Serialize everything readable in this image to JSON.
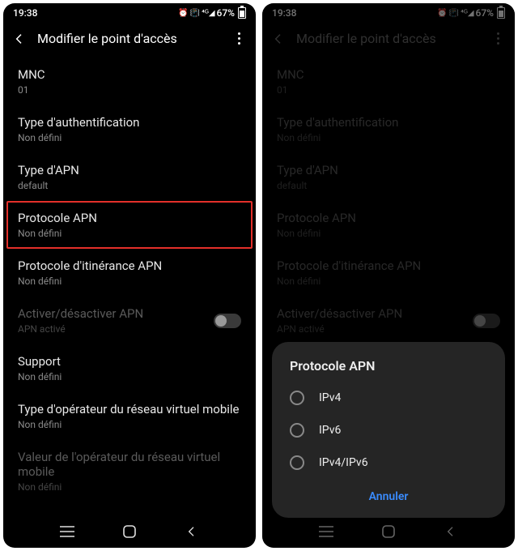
{
  "statusbar": {
    "time": "19:38",
    "battery": "67%"
  },
  "header": {
    "title": "Modifier le point d'accès"
  },
  "items": [
    {
      "label": "MNC",
      "value": "01"
    },
    {
      "label": "Type d'authentification",
      "value": "Non défini"
    },
    {
      "label": "Type d'APN",
      "value": "default"
    },
    {
      "label": "Protocole APN",
      "value": "Non défini"
    },
    {
      "label": "Protocole d'itinérance APN",
      "value": "Non défini"
    },
    {
      "label": "Activer/désactiver APN",
      "value": "APN activé"
    },
    {
      "label": "Support",
      "value": "Non défini"
    },
    {
      "label": "Type d'opérateur du réseau virtuel mobile",
      "value": "Non défini"
    },
    {
      "label": "Valeur de l'opérateur du réseau virtuel mobile",
      "value": "Non défini"
    }
  ],
  "dialog": {
    "title": "Protocole APN",
    "options": [
      "IPv4",
      "IPv6",
      "IPv4/IPv6"
    ],
    "cancel": "Annuler"
  }
}
